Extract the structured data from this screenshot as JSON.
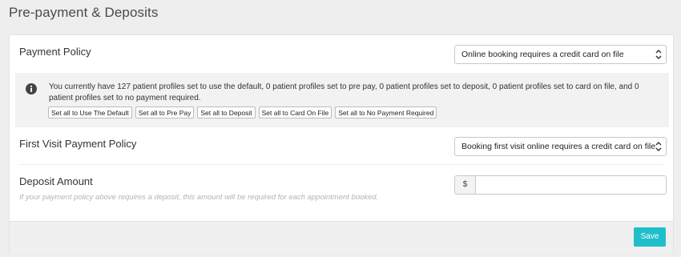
{
  "page": {
    "title": "Pre-payment & Deposits"
  },
  "payment_policy": {
    "label": "Payment Policy",
    "selected": "Online booking requires a credit card on file"
  },
  "info": {
    "icon": "info-icon",
    "message": "You currently have 127 patient profiles set to use the default, 0 patient profiles set to pre pay, 0 patient profiles set to deposit, 0 patient profiles set to card on file, and 0 patient profiles set to no payment required.",
    "buttons": [
      "Set all to Use The Default",
      "Set all to Pre Pay",
      "Set all to Deposit",
      "Set all to Card On File",
      "Set all to No Payment Required"
    ]
  },
  "first_visit_policy": {
    "label": "First Visit Payment Policy",
    "selected": "Booking first visit online requires a credit card on file"
  },
  "deposit": {
    "label": "Deposit Amount",
    "hint": "If your payment policy above requires a deposit, this amount will be required for each appointment booked.",
    "currency_symbol": "$",
    "value": ""
  },
  "footer": {
    "save_label": "Save"
  },
  "colors": {
    "accent": "#1fbfc9",
    "info_bg": "#f2f2f2"
  }
}
